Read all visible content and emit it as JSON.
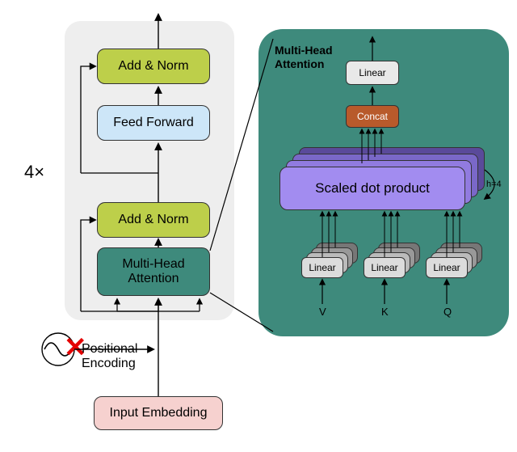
{
  "repeat_label": "4×",
  "encoder": {
    "add_norm": "Add & Norm",
    "feed_forward": "Feed Forward",
    "multi_head_attention": "Multi-Head\nAttention"
  },
  "positional_encoding": "Positional\nEncoding",
  "input_embedding": "Input Embedding",
  "mha_detail": {
    "title": "Multi-Head\nAttention",
    "linear_out": "Linear",
    "concat": "Concat",
    "scaled_dot": "Scaled dot product",
    "linear_in": "Linear",
    "heads_label": "h=4",
    "inputs": {
      "v": "V",
      "k": "K",
      "q": "Q"
    }
  },
  "colors": {
    "addnorm": "#bdcf4a",
    "ff": "#cde6f8",
    "mha": "#3e8a7c",
    "input": "#f6d1cf",
    "sdp": "#a28cf0",
    "concat": "#b85a2b",
    "linear": "#e9e9e9"
  }
}
